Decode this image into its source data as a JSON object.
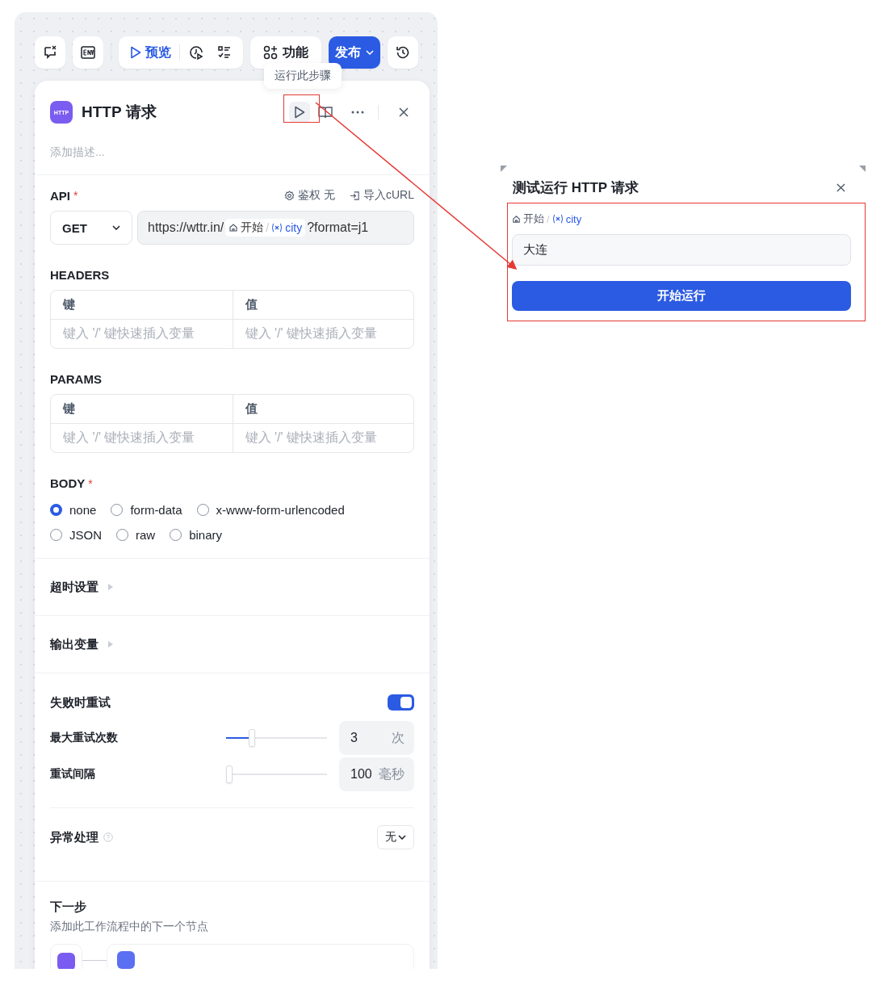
{
  "toolbar": {
    "preview_label": "预览",
    "features_label": "功能",
    "publish_label": "发布"
  },
  "tooltip": "运行此步骤",
  "node": {
    "badge": "HTTP",
    "title": "HTTP 请求",
    "description_placeholder": "添加描述..."
  },
  "api": {
    "label": "API",
    "required_mark": "*",
    "auth_label": "鉴权",
    "auth_value": "无",
    "import_label": "导入cURL",
    "method": "GET",
    "url_prefix": "https://wttr.in/",
    "var_node": "开始",
    "separator": "/",
    "var_name": "city",
    "url_suffix": "?format=j1"
  },
  "tables": [
    {
      "label": "HEADERS",
      "columns": [
        "键",
        "值"
      ],
      "placeholders": [
        "键入 '/' 键快速插入变量",
        "键入 '/' 键快速插入变量"
      ]
    },
    {
      "label": "PARAMS",
      "columns": [
        "键",
        "值"
      ],
      "placeholders": [
        "键入 '/' 键快速插入变量",
        "键入 '/' 键快速插入变量"
      ]
    }
  ],
  "body": {
    "label": "BODY",
    "required_mark": "*",
    "options": [
      {
        "label": "none",
        "selected": true
      },
      {
        "label": "form-data",
        "selected": false
      },
      {
        "label": "x-www-form-urlencoded",
        "selected": false
      },
      {
        "label": "JSON",
        "selected": false
      },
      {
        "label": "raw",
        "selected": false
      },
      {
        "label": "binary",
        "selected": false
      }
    ]
  },
  "collapsibles": [
    {
      "label": "超时设置",
      "expanded": false
    },
    {
      "label": "输出变量",
      "expanded": false
    }
  ],
  "retry": {
    "label": "失败时重试",
    "on": true,
    "settings": [
      {
        "label": "最大重试次数",
        "level": 0.24,
        "value": "3",
        "unit": "次"
      },
      {
        "label": "重试间隔",
        "level": 0,
        "value": "100",
        "unit": "毫秒"
      }
    ]
  },
  "error_handling": {
    "label": "异常处理",
    "value": "无"
  },
  "next_step": {
    "title": "下一步",
    "description": "添加此工作流程中的下一个节点"
  },
  "test_run_dialog": {
    "title": "测试运行 HTTP 请求",
    "var_node": "开始",
    "separator": "/",
    "var_name": "city",
    "value": "大连",
    "run_button": "开始运行"
  }
}
